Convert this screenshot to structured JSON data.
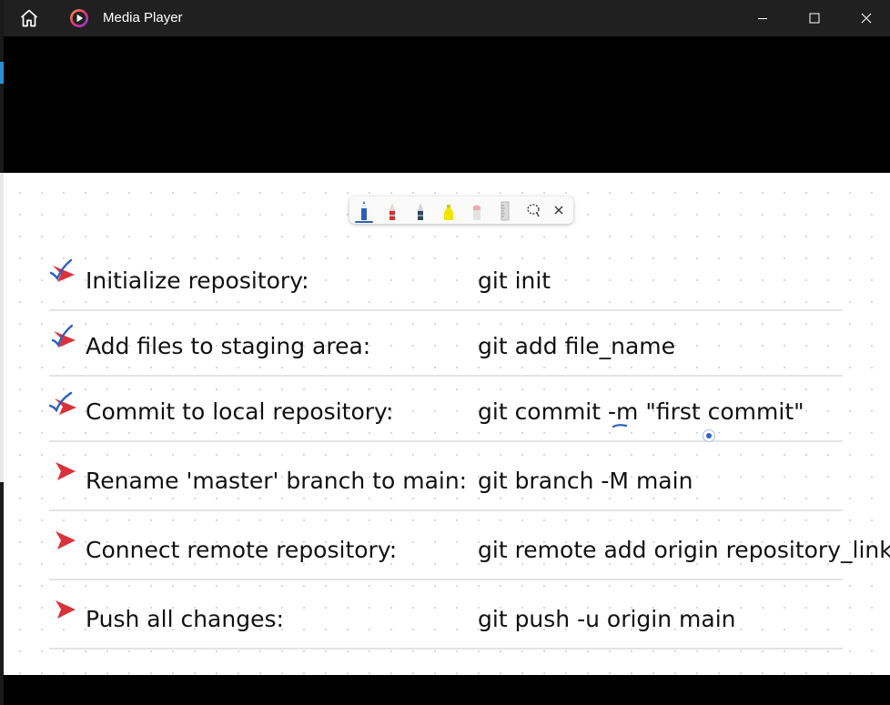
{
  "app": {
    "title": "Media Player",
    "icons": [
      "home-icon",
      "media-player-icon",
      "minimize-icon",
      "maximize-icon",
      "close-icon"
    ]
  },
  "ink_toolbar": {
    "tools": [
      {
        "name": "ballpoint-pen-blue",
        "color": "#2f5fb3",
        "active": true
      },
      {
        "name": "pen-red",
        "color": "#d0312d",
        "active": false
      },
      {
        "name": "pen-dark",
        "color": "#33475b",
        "active": false
      },
      {
        "name": "highlighter-yellow",
        "color": "#f2e600",
        "active": false
      },
      {
        "name": "eraser",
        "color": "#f0a8b4",
        "active": false
      },
      {
        "name": "ruler",
        "color": "#c8c8c8",
        "active": false
      },
      {
        "name": "lasso-select",
        "color": "#333333",
        "active": false
      },
      {
        "name": "close-ink",
        "color": "#333333",
        "active": false
      }
    ]
  },
  "steps": [
    {
      "label": "Initialize repository:",
      "command": "git init",
      "checked": true
    },
    {
      "label": "Add files to staging area:",
      "command": "git add file_name",
      "checked": true
    },
    {
      "label": "Commit to local repository:",
      "command": "git commit -m \"first commit\"",
      "checked": true
    },
    {
      "label": "Rename 'master' branch to main:",
      "command": "git branch -M main",
      "checked": false
    },
    {
      "label": "Connect remote repository:",
      "command": "git remote add origin repository_link",
      "checked": false
    },
    {
      "label": "Push all changes:",
      "command": "git push -u origin main",
      "checked": false
    }
  ],
  "colors": {
    "titlebar": "#202020",
    "bullet": "#d8323a",
    "ink_check": "#2a5fbf",
    "board": "#ffffff"
  }
}
